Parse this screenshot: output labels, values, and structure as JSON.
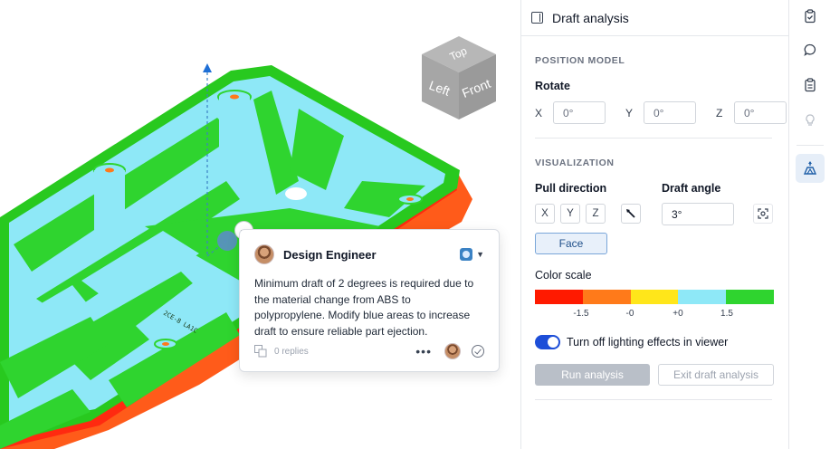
{
  "viewer": {
    "view_cube": {
      "top": "Top",
      "left": "Left",
      "front": "Front"
    },
    "part_engraving": "2CE-8 LA1C"
  },
  "comment": {
    "author": "Design Engineer",
    "body": "Minimum draft of 2 degrees is required due to the material change from ABS to polypropylene. Modify blue areas to increase draft to ensure reliable part ejection.",
    "replies": "0 replies",
    "more": "•••"
  },
  "panel": {
    "title": "Draft analysis",
    "position_model": {
      "heading": "POSITION MODEL",
      "rotate_label": "Rotate",
      "x_label": "X",
      "x_value": "0°",
      "y_label": "Y",
      "y_value": "0°",
      "z_label": "Z",
      "z_value": "0°"
    },
    "visualization": {
      "heading": "VISUALIZATION",
      "pull_direction_label": "Pull direction",
      "pull_x": "X",
      "pull_y": "Y",
      "pull_z": "Z",
      "draft_angle_label": "Draft angle",
      "draft_angle_value": "3°",
      "face_button": "Face",
      "color_scale_label": "Color scale",
      "color_scale": [
        "#ff1a00",
        "#ff7a1a",
        "#ffe61a",
        "#8ee8f7",
        "#2fd42f"
      ],
      "scale_ticks": [
        "-1.5",
        "-0",
        "+0",
        "1.5"
      ],
      "lighting_toggle_label": "Turn off lighting effects in viewer",
      "lighting_toggle_on": true,
      "run_button": "Run analysis",
      "exit_button": "Exit draft analysis"
    }
  },
  "rail": {
    "icons": [
      "clipboard-check-icon",
      "chat-bubble-icon",
      "checklist-icon",
      "lightbulb-icon",
      "draft-analysis-icon"
    ],
    "active": "draft-analysis-icon"
  }
}
